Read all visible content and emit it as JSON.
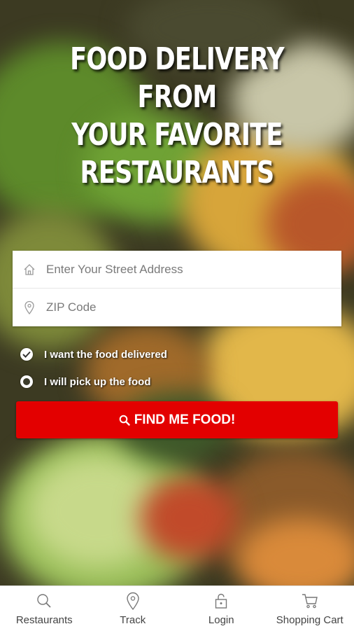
{
  "hero": {
    "line1": "FOOD DELIVERY FROM",
    "line2": "YOUR FAVORITE",
    "line3": "RESTAURANTS"
  },
  "form": {
    "address_placeholder": "Enter Your Street Address",
    "address_value": "",
    "zip_placeholder": "ZIP Code",
    "zip_value": "",
    "address_icon": "home-icon",
    "zip_icon": "map-pin-icon"
  },
  "options": {
    "delivery_label": "I want the food delivered",
    "delivery_selected": true,
    "pickup_label": "I will pick up the food",
    "pickup_selected": false
  },
  "action": {
    "find_label": "FIND ME FOOD!",
    "find_icon": "search-icon",
    "button_color": "#e30000"
  },
  "tabbar": {
    "tabs": [
      {
        "label": "Restaurants",
        "icon": "search-icon"
      },
      {
        "label": "Track",
        "icon": "map-pin-icon"
      },
      {
        "label": "Login",
        "icon": "lock-icon"
      },
      {
        "label": "Shopping Cart",
        "icon": "cart-icon"
      }
    ]
  }
}
